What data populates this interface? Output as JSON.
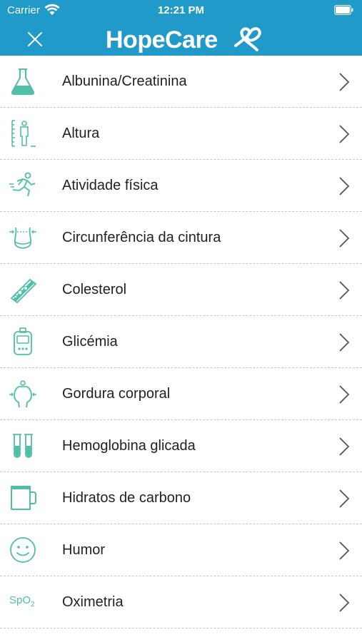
{
  "status_bar": {
    "carrier": "Carrier",
    "time": "12:21 PM"
  },
  "header": {
    "logo_text": "HopeCare",
    "icon": "close-icon"
  },
  "colors": {
    "primary": "#1f9ac9",
    "icon_accent": "#4fbfa5"
  },
  "items": [
    {
      "label": "Albunina/Creatinina",
      "icon": "flask-icon"
    },
    {
      "label": "Altura",
      "icon": "height-icon"
    },
    {
      "label": "Atividade física",
      "icon": "running-icon"
    },
    {
      "label": "Circunferência da cintura",
      "icon": "waist-icon"
    },
    {
      "label": "Colesterol",
      "icon": "cholesterol-icon"
    },
    {
      "label": "Glicémia",
      "icon": "glucometer-icon"
    },
    {
      "label": "Gordura corporal",
      "icon": "body-fat-icon"
    },
    {
      "label": "Hemoglobina glicada",
      "icon": "test-tubes-icon"
    },
    {
      "label": "Hidratos de carbono",
      "icon": "cup-icon"
    },
    {
      "label": "Humor",
      "icon": "smiley-icon"
    },
    {
      "label": "Oximetria",
      "icon": "spo2-icon",
      "icon_text": "SpO",
      "icon_sub": "2"
    }
  ]
}
